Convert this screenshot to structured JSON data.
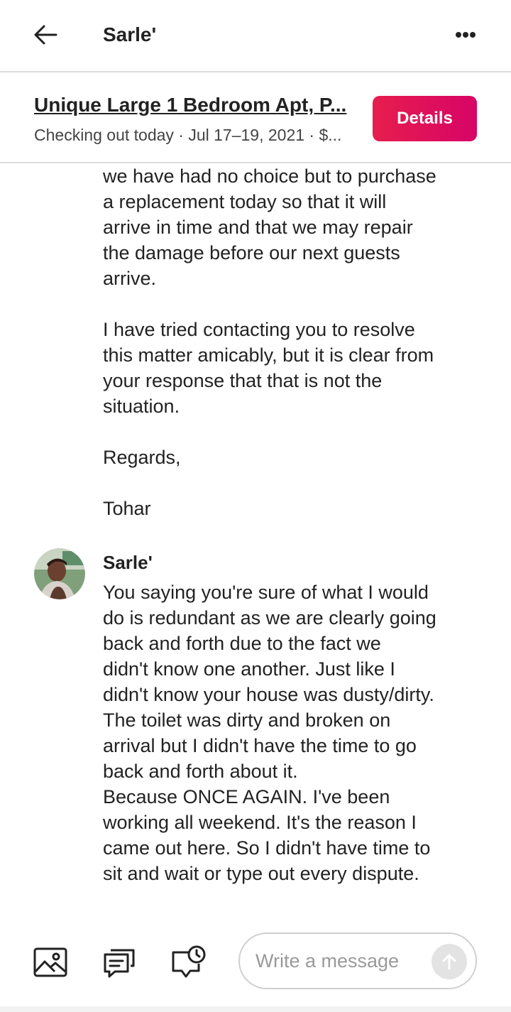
{
  "header": {
    "title": "Sarle'"
  },
  "listing": {
    "title": "Unique Large 1 Bedroom Apt, P...",
    "subtitle": "Checking out today · Jul 17–19, 2021 · $...",
    "details_label": "Details",
    "accent_color": "#e61e4d"
  },
  "messages": [
    {
      "text": "we have had no choice but to purchase\na replacement today so that it will\narrive in time and that we may repair\nthe damage before our next guests\narrive.\n\nI have tried contacting you to resolve\nthis matter amicably, but it is clear from\nyour response that that is not the\nsituation.\n\nRegards,\n\nTohar"
    },
    {
      "sender": "Sarle'",
      "text": "You saying you're sure of what I would\ndo is redundant as we are clearly going\nback and forth due to the fact we\ndidn't know one another. Just like I\ndidn't know your house was dusty/dirty.\nThe toilet was dirty and broken on\narrival but I didn't have the time to go\nback and forth about it.\nBecause ONCE AGAIN. I've been\nworking all weekend. It's the reason I\ncame out here. So I didn't have time to\nsit and wait or type out every dispute."
    }
  ],
  "composer": {
    "placeholder": "Write a message",
    "icons": [
      "image-icon",
      "quick-reply-icon",
      "scheduled-message-icon",
      "send-arrow-icon"
    ]
  }
}
